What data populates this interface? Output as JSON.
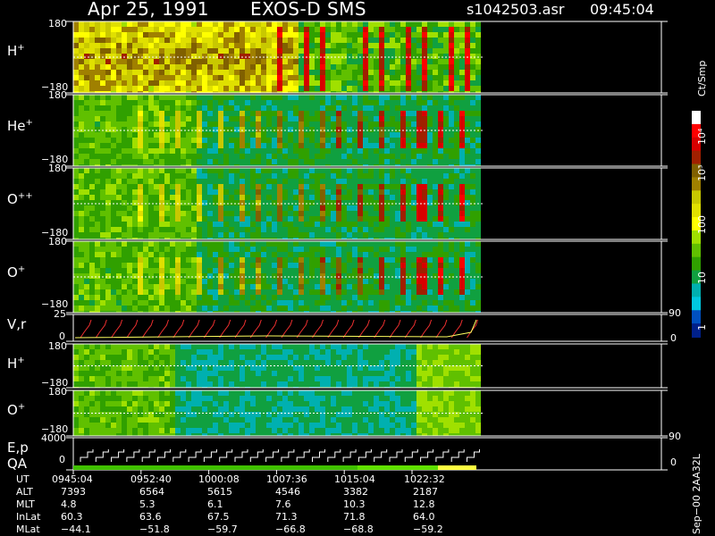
{
  "header": {
    "date": "Apr 25, 1991",
    "instrument": "EXOS-D SMS",
    "file": "s1042503.asr",
    "time": "09:45:04"
  },
  "colorbar": {
    "unit": "Ct/Smp",
    "ticks": [
      "10⁴",
      "10³",
      "100",
      "10",
      "1"
    ],
    "colors": [
      "#ffffff",
      "#ff0000",
      "#d80000",
      "#a02000",
      "#806000",
      "#a08000",
      "#c8c800",
      "#e0e000",
      "#ffff00",
      "#a0e000",
      "#60c000",
      "#30a000",
      "#10a040",
      "#00b0b0",
      "#00c8e0",
      "#0050c0",
      "#00208a"
    ]
  },
  "panels": [
    {
      "label": "H",
      "sup": "+",
      "ymax": "180",
      "ymin": "−180"
    },
    {
      "label": "He",
      "sup": "+",
      "ymax": "180",
      "ymin": "−180"
    },
    {
      "label": "O",
      "sup": "++",
      "ymax": "180",
      "ymin": "−180"
    },
    {
      "label": "O",
      "sup": "+",
      "ymax": "180",
      "ymin": "−180"
    }
  ],
  "vr_panel": {
    "label": "V,r",
    "ymax": "25",
    "ymin": "0",
    "right_max": "90",
    "right_min": "0"
  },
  "lower_panels": [
    {
      "label": "H",
      "sup": "+",
      "ymax": "180",
      "ymin": "−180"
    },
    {
      "label": "O",
      "sup": "+",
      "ymax": "180",
      "ymin": "−180"
    }
  ],
  "ep_panel": {
    "label": "E,p",
    "label2": "QA",
    "ymax": "4000",
    "ymin": "0",
    "right_max": "90",
    "right_min": "0"
  },
  "footer_id": "Sep−00  2AA32L",
  "chart_data": {
    "type": "heatmap",
    "title": "Apr 25, 1991    EXOS-D SMS",
    "xlabel": "UT",
    "x_ticks": [
      "0945:04",
      "0952:40",
      "1000:08",
      "1007:36",
      "1015:04",
      "1022:32"
    ],
    "colorbar_label": "Ct/Smp",
    "colorbar_range": [
      1,
      10000
    ],
    "colorbar_scale": "log"
  },
  "table": {
    "rows": [
      {
        "label": "UT",
        "values": [
          "0945:04",
          "0952:40",
          "1000:08",
          "1007:36",
          "1015:04",
          "1022:32"
        ]
      },
      {
        "label": "ALT",
        "values": [
          "7393",
          "6564",
          "5615",
          "4546",
          "3382",
          "2187"
        ]
      },
      {
        "label": "MLT",
        "values": [
          "4.8",
          "5.3",
          "6.1",
          "7.6",
          "10.3",
          "12.8"
        ]
      },
      {
        "label": "InLat",
        "values": [
          "60.3",
          "63.6",
          "67.5",
          "71.3",
          "71.8",
          "64.0"
        ]
      },
      {
        "label": "MLat",
        "values": [
          "−44.1",
          "−51.8",
          "−59.7",
          "−66.8",
          "−68.8",
          "−59.2"
        ]
      }
    ]
  }
}
